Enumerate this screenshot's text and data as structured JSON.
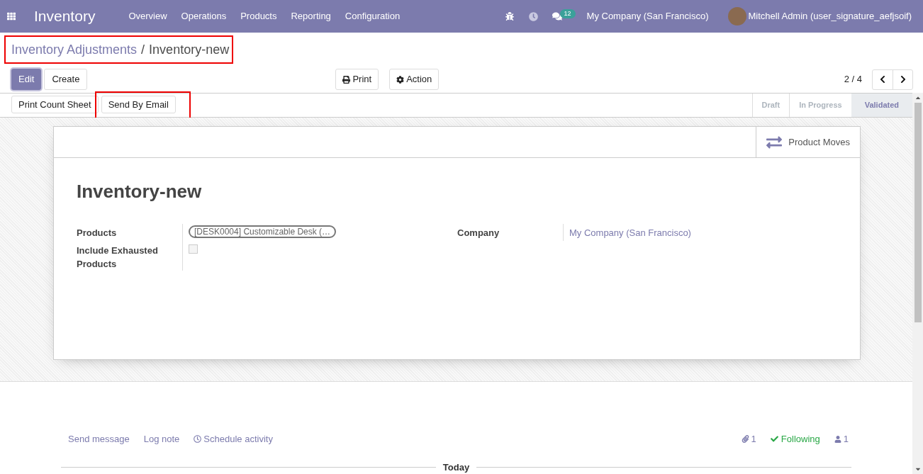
{
  "navbar": {
    "app_name": "Inventory",
    "menu": [
      "Overview",
      "Operations",
      "Products",
      "Reporting",
      "Configuration"
    ],
    "message_count": "12",
    "company": "My Company (San Francisco)",
    "user": "Mitchell Admin (user_signature_aefjsoif)"
  },
  "breadcrumb": {
    "parent": "Inventory Adjustments",
    "separator": "/",
    "current": "Inventory-new",
    "highlighted": true
  },
  "toolbar": {
    "buttons": [
      {
        "label": "Edit",
        "primary": true
      },
      {
        "label": "Create",
        "primary": false
      }
    ],
    "menus": [
      {
        "kind": "print",
        "label": "Print"
      },
      {
        "kind": "action",
        "label": "Action"
      }
    ],
    "pager": "2 / 4"
  },
  "header_buttons": [
    {
      "label": "Print Count Sheet",
      "highlighted": false
    },
    {
      "label": "Send By Email",
      "highlighted": true
    }
  ],
  "stages": [
    {
      "label": "Draft",
      "selected": false
    },
    {
      "label": "In Progress",
      "selected": false
    },
    {
      "label": "Validated",
      "selected": true
    }
  ],
  "smart_button": "Product Moves",
  "form": {
    "title": "Inventory-new",
    "products_label": "Products",
    "products_tag": "[DESK0004] Customizable Desk (…",
    "exhausted_label": "Include Exhausted Products",
    "exhausted_checked": false,
    "company_label": "Company",
    "company_value": "My Company (San Francisco)"
  },
  "chatter": {
    "actions": [
      {
        "kind": "plain",
        "label": "Send message"
      },
      {
        "kind": "plain",
        "label": "Log note"
      },
      {
        "kind": "clock",
        "label": "Schedule activity"
      }
    ],
    "attachments": "1",
    "following": "Following",
    "followers": "1",
    "divider": "Today"
  }
}
